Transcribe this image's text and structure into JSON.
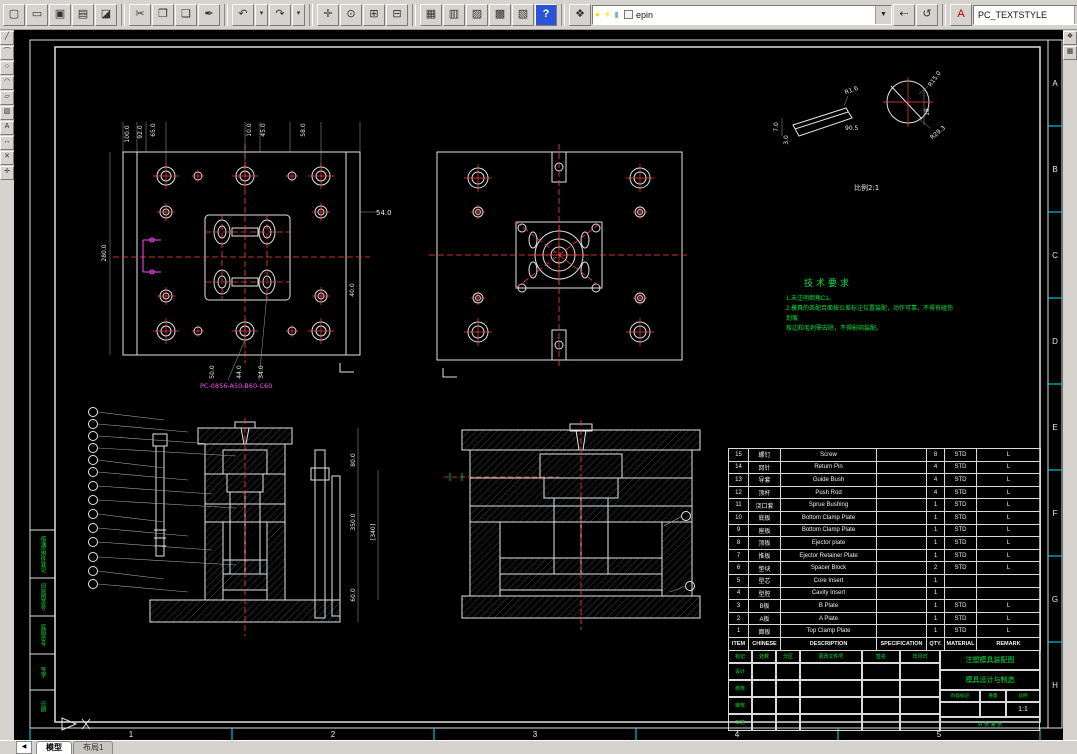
{
  "toolbar": {
    "layer_value": "epin",
    "textstyle_value": "PC_TEXTSTYLE"
  },
  "canvas": {
    "zone_letters": [
      "A",
      "B",
      "C",
      "D",
      "E",
      "F",
      "G",
      "H"
    ],
    "zone_numbers": [
      "1",
      "2",
      "3",
      "4",
      "5"
    ],
    "frame_labels": [
      "借(通)用件登记",
      "旧底图总号",
      "底图总号",
      "签字",
      "日期"
    ],
    "view1": {
      "dims_top": [
        "100.0",
        "92.0",
        "65.0",
        "10.0",
        "45.0",
        "58.0"
      ],
      "dim_left": "280.0",
      "dim_right_top": "54.0",
      "dim_right_mid": "40.0",
      "dims_bottom": [
        "50.0",
        "44.0",
        "34.0"
      ],
      "code": "PC-0856-A50-B60-C60"
    },
    "view3": {
      "dims": [
        "R1.6",
        "90.5",
        "7.0",
        "3.0",
        "R15.0",
        "18",
        "R29.3"
      ],
      "scale_note": "比例2:1"
    },
    "view4": {
      "dims_right": [
        "80.0",
        "350.0",
        "[340]",
        "60.0"
      ]
    },
    "tech": {
      "title": "技术要求",
      "lines": [
        "1.未注明倒角C1。",
        "2.模具的各配合面按公差标注位置装配，动作可靠，不得有碰伤划痕",
        "棱边和毛刺需去除，不得影响装配。"
      ]
    }
  },
  "bom": {
    "headers": [
      "ITEM",
      "CHINESE",
      "DESCRIPTION",
      "SPECIFICATION",
      "QTY.",
      "MATERIAL",
      "REMARK"
    ],
    "rows": [
      [
        "15",
        "螺钉",
        "Screw",
        "",
        "8",
        "STD",
        "L"
      ],
      [
        "14",
        "回针",
        "Return Pin",
        "",
        "4",
        "STD",
        "L"
      ],
      [
        "13",
        "导套",
        "Guide Bush",
        "",
        "4",
        "STD",
        "L"
      ],
      [
        "12",
        "顶杆",
        "Push Rod",
        "",
        "4",
        "STD",
        "L"
      ],
      [
        "11",
        "浇口套",
        "Sprue Bushing",
        "",
        "1",
        "STD",
        "L"
      ],
      [
        "10",
        "底板",
        "Bottom Clamp Plate",
        "",
        "1",
        "STD",
        "L"
      ],
      [
        "9",
        "座板",
        "Bottom Clamp Plate",
        "",
        "1",
        "STD",
        "L"
      ],
      [
        "8",
        "顶板",
        "Ejector plate",
        "",
        "1",
        "STD",
        "L"
      ],
      [
        "7",
        "推板",
        "Ejector Retainer Plate",
        "",
        "1",
        "STD",
        "L"
      ],
      [
        "6",
        "垫块",
        "Spacer Block",
        "",
        "2",
        "STD",
        "L"
      ],
      [
        "5",
        "型芯",
        "Core Insert",
        "",
        "1",
        "",
        ""
      ],
      [
        "4",
        "型腔",
        "Cavity Insert",
        "",
        "1",
        "",
        ""
      ],
      [
        "3",
        "B板",
        "B Plate",
        "",
        "1",
        "STD",
        "L"
      ],
      [
        "2",
        "A板",
        "A Plate",
        "",
        "1",
        "STD",
        "L"
      ],
      [
        "1",
        "面板",
        "Top Clamp Plate",
        "",
        "1",
        "STD",
        "L"
      ]
    ]
  },
  "titleblock": {
    "title_line1": "注塑模具装配图",
    "title_line2": "模具设计与制造",
    "rev_labels": [
      "标记",
      "处数",
      "分区",
      "更改文件号",
      "签名",
      "年月日"
    ],
    "sign_labels": [
      "设计",
      "校核",
      "审核",
      "工艺"
    ],
    "right_labels": [
      "阶段标记",
      "重量",
      "比例"
    ],
    "scale_value": "1:1",
    "sheet_note": "共 张 第 张"
  },
  "tabs": {
    "model": "模型",
    "layout1": "布局1"
  }
}
